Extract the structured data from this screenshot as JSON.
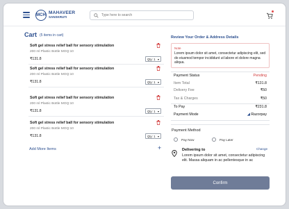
{
  "header": {
    "logo_badge": "MCH",
    "logo_name": "MAHAVEER",
    "logo_sub": "SANSKRUTI",
    "search_placeholder": "Type here to search"
  },
  "cart": {
    "title": "Cart",
    "count_text": "(5 items in cart)",
    "items": [
      {
        "name": "Soft gel stress relief ball for sensory stimulation",
        "sub": "200 ml Plastic Bottle   MOQ:10",
        "price": "₹131.8",
        "qty": "Qty: 1"
      },
      {
        "name": "Soft gel stress relief ball for sensory stimulation",
        "sub": "200 ml Plastic Bottle   MOQ:10",
        "price": "₹131.8",
        "qty": "Qty: 1"
      },
      {
        "name": "Soft gel stress relief ball for sensory stimulation",
        "sub": "200 ml Plastic Bottle   MOQ:10",
        "price": "₹131.8",
        "qty": "Qty: 1"
      },
      {
        "name": "Soft gel stress relief ball for sensory stimulation",
        "sub": "200 ml Plastic Bottle   MOQ:10",
        "price": "₹131.8",
        "qty": "Qty: 1"
      }
    ],
    "add_more_label": "Add More Items"
  },
  "review": {
    "title": "Review Your Order & Address Details",
    "note_label": "Note",
    "note_text": "Lorem ipsum dolor sit amet, consectetur adipiscing elit, sed do eiusmod tempor incididunt ut labore et dolore magna aliqua."
  },
  "summary": {
    "payment_status_label": "Payment Status",
    "payment_status_value": "Pending",
    "item_total_label": "Item Total",
    "item_total_value": "₹131.8",
    "delivery_fee_label": "Delivery Fee",
    "delivery_fee_value": "₹50",
    "tax_label": "Tax & Charges",
    "tax_value": "₹50",
    "to_pay_label": "To Pay",
    "to_pay_value": "₹231.8",
    "payment_mode_label": "Payment Mode",
    "payment_mode_value": "Razorpay"
  },
  "payment_method": {
    "title": "Payment Method",
    "options": [
      "Pay Now",
      "Pay Later"
    ]
  },
  "delivery": {
    "title": "Delivering to",
    "change_label": "Change",
    "address": "Lorem ipsum dolor sit amet, consectetur adipiscing elit. Massa aliquam in ac pellentesque in ac"
  },
  "confirm_label": "Confirm",
  "colors": {
    "brand": "#2c4f8f",
    "danger": "#d23b3b",
    "confirm_bg": "#6f7c98"
  }
}
